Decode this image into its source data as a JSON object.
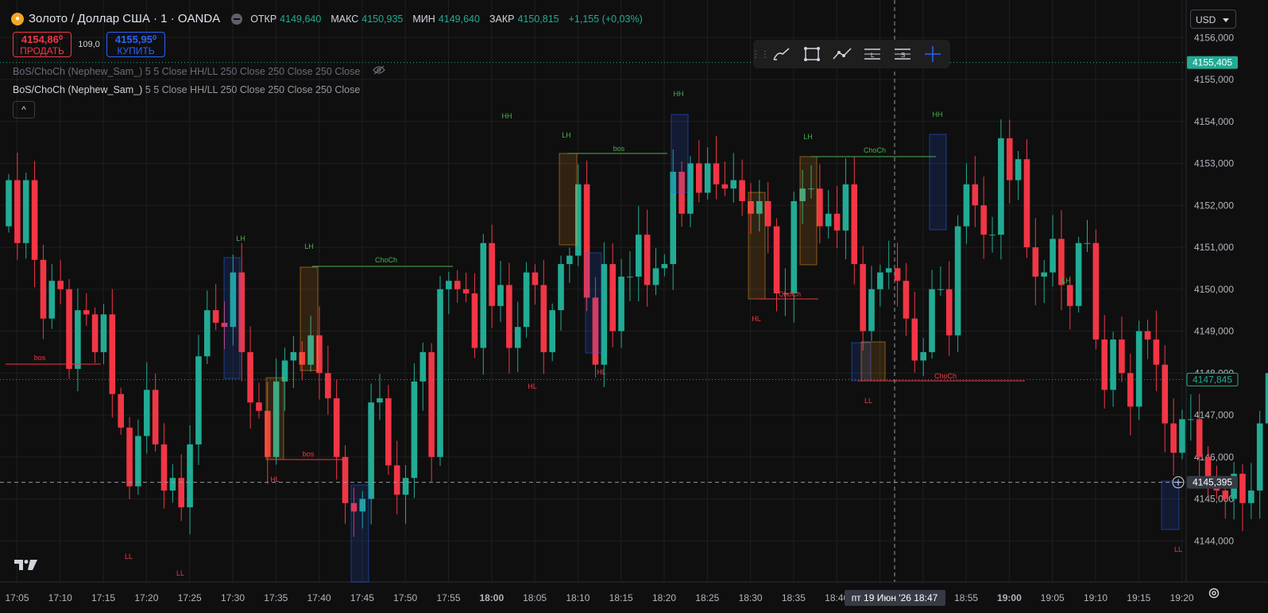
{
  "header": {
    "symbol": "Золото / Доллар США · 1 · OANDA",
    "symbol_icon": "gold-coin-icon",
    "ohlc": [
      {
        "label": "ОТКР",
        "value": "4149,640"
      },
      {
        "label": "МАКС",
        "value": "4150,935"
      },
      {
        "label": "МИН",
        "value": "4149,640"
      },
      {
        "label": "ЗАКР",
        "value": "4150,815"
      }
    ],
    "change": "+1,155 (+0,03%)"
  },
  "trade": {
    "sell_price": "4154,86⁰",
    "sell_label": "ПРОДАТЬ",
    "spread": "109,0",
    "buy_price": "4155,95⁰",
    "buy_label": "КУПИТЬ"
  },
  "indicators": {
    "hidden": {
      "name": "BoS/ChoCh (Nephew_Sam_)",
      "params": "5 5 Close HH/LL 250 Close 250 Close 250 Close"
    },
    "visible": {
      "name": "BoS/ChoCh (Nephew_Sam_)",
      "params": "5 5 Close HH/LL 250 Close 250 Close 250 Close"
    },
    "collapse": "^"
  },
  "currency": "USD",
  "crosshair": {
    "date_label": "пт 19 Июн '26",
    "time_label": "18:47",
    "price_label": "4145,395"
  },
  "colors": {
    "up": "#22ab94",
    "down": "#f23645",
    "bg": "#0f0f0f",
    "grid": "#1f1f1f"
  },
  "chart_data": {
    "type": "candlestick",
    "y_ticks": [
      "4144,000",
      "4145,000",
      "4146,000",
      "4147,000",
      "4148,000",
      "4149,000",
      "4150,000",
      "4151,000",
      "4152,000",
      "4153,000",
      "4154,000",
      "4155,000",
      "4156,000"
    ],
    "x_ticks": [
      {
        "label": "17:05",
        "bold": false
      },
      {
        "label": "17:10",
        "bold": false
      },
      {
        "label": "17:15",
        "bold": false
      },
      {
        "label": "17:20",
        "bold": false
      },
      {
        "label": "17:25",
        "bold": false
      },
      {
        "label": "17:30",
        "bold": false
      },
      {
        "label": "17:35",
        "bold": false
      },
      {
        "label": "17:40",
        "bold": false
      },
      {
        "label": "17:45",
        "bold": false
      },
      {
        "label": "17:50",
        "bold": false
      },
      {
        "label": "17:55",
        "bold": false
      },
      {
        "label": "18:00",
        "bold": true
      },
      {
        "label": "18:05",
        "bold": false
      },
      {
        "label": "18:10",
        "bold": false
      },
      {
        "label": "18:15",
        "bold": false
      },
      {
        "label": "18:20",
        "bold": false
      },
      {
        "label": "18:25",
        "bold": false
      },
      {
        "label": "18:30",
        "bold": false
      },
      {
        "label": "18:35",
        "bold": false
      },
      {
        "label": "18:40",
        "bold": false
      },
      {
        "label": "18:45",
        "bold": false
      },
      {
        "label": "18:50",
        "bold": false
      },
      {
        "label": "18:55",
        "bold": false
      },
      {
        "label": "19:00",
        "bold": true
      },
      {
        "label": "19:05",
        "bold": false
      },
      {
        "label": "19:10",
        "bold": false
      },
      {
        "label": "19:15",
        "bold": false
      },
      {
        "label": "19:20",
        "bold": false
      }
    ],
    "last_price": "4147,845",
    "ask_price": "4155,405",
    "closes": [
      4152.6,
      4151.1,
      4152.6,
      4150.7,
      4149.3,
      4150.2,
      4150.0,
      4148.1,
      4149.5,
      4149.4,
      4148.5,
      4149.4,
      4147.5,
      4146.7,
      4145.3,
      4146.5,
      4147.6,
      4146.3,
      4145.2,
      4145.5,
      4144.8,
      4146.3,
      4148.4,
      4149.5,
      4149.2,
      4149.1,
      4150.4,
      4148.5,
      4147.3,
      4147.1,
      4146.0,
      4147.8,
      4148.3,
      4148.5,
      4148.2,
      4148.9,
      4148.0,
      4147.4,
      4146.0,
      4144.9,
      4144.7,
      4145.0,
      4147.3,
      4147.4,
      4145.8,
      4145.1,
      4145.5,
      4147.8,
      4148.5,
      4146.0,
      4150.0,
      4150.2,
      4150.0,
      4149.9,
      4148.6,
      4151.1,
      4149.6,
      4150.1,
      4148.6,
      4149.1,
      4150.4,
      4150.1,
      4148.5,
      4149.5,
      4150.6,
      4150.8,
      4152.5,
      4149.8,
      4148.2,
      4150.6,
      4149.0,
      4150.3,
      4150.3,
      4151.3,
      4150.1,
      4150.5,
      4150.6,
      4152.8,
      4151.8,
      4153.0,
      4152.3,
      4153.0,
      4152.5,
      4152.4,
      4152.6,
      4152.1,
      4151.8,
      4152.1,
      4151.5,
      4149.9,
      4149.9,
      4152.1,
      4152.4,
      4152.4,
      4151.5,
      4151.8,
      4151.4,
      4152.5,
      4150.6,
      4149.0,
      4150.0,
      4150.4,
      4150.5,
      4150.2,
      4149.3,
      4148.3,
      4148.5,
      4150.0,
      4150.0,
      4148.9,
      4151.5,
      4152.5,
      4152.0,
      4151.3,
      4151.3,
      4153.6,
      4152.6,
      4153.1,
      4151.0,
      4150.3,
      4150.4,
      4151.2,
      4150.1,
      4149.6,
      4151.1,
      4151.1,
      4148.8,
      4147.6,
      4148.8,
      4148.0,
      4147.2,
      4149.0,
      4148.8,
      4148.2,
      4146.8,
      4146.1,
      4146.9,
      4146.9,
      4146.0,
      4145.4,
      4145.2,
      4145.0,
      4145.6,
      4144.9,
      4145.2,
      4146.8,
      4148.0
    ]
  },
  "structure_labels": [
    {
      "t": "LH",
      "c": "g"
    },
    {
      "t": "LH",
      "c": "g"
    },
    {
      "t": "HH",
      "c": "g"
    },
    {
      "t": "LH",
      "c": "g"
    },
    {
      "t": "HH",
      "c": "g"
    },
    {
      "t": "LH",
      "c": "g"
    },
    {
      "t": "HH",
      "c": "g"
    },
    {
      "t": "LH",
      "c": "g"
    },
    {
      "t": "HL",
      "c": "r"
    },
    {
      "t": "HL",
      "c": "r"
    },
    {
      "t": "HL",
      "c": "r"
    },
    {
      "t": "HL",
      "c": "r"
    },
    {
      "t": "LL",
      "c": "r"
    },
    {
      "t": "LL",
      "c": "r"
    },
    {
      "t": "LL",
      "c": "r"
    },
    {
      "t": "LL",
      "c": "r"
    }
  ],
  "structure_lines": [
    {
      "t": "bos",
      "c": "r"
    },
    {
      "t": "ChoCh",
      "c": "g"
    },
    {
      "t": "bos",
      "c": "r"
    },
    {
      "t": "bos",
      "c": "g"
    },
    {
      "t": "ChoCh",
      "c": "r"
    },
    {
      "t": "ChoCh",
      "c": "g"
    },
    {
      "t": "ChoCh",
      "c": "r"
    }
  ],
  "toolbar_icons": [
    "drag-handle-icon",
    "trendline-brush-icon",
    "rectangle-icon",
    "path-icon",
    "long-position-icon",
    "short-position-icon",
    "crosshair-icon"
  ],
  "footer": {
    "logo": "TV",
    "settings_icon": "gear-icon"
  }
}
